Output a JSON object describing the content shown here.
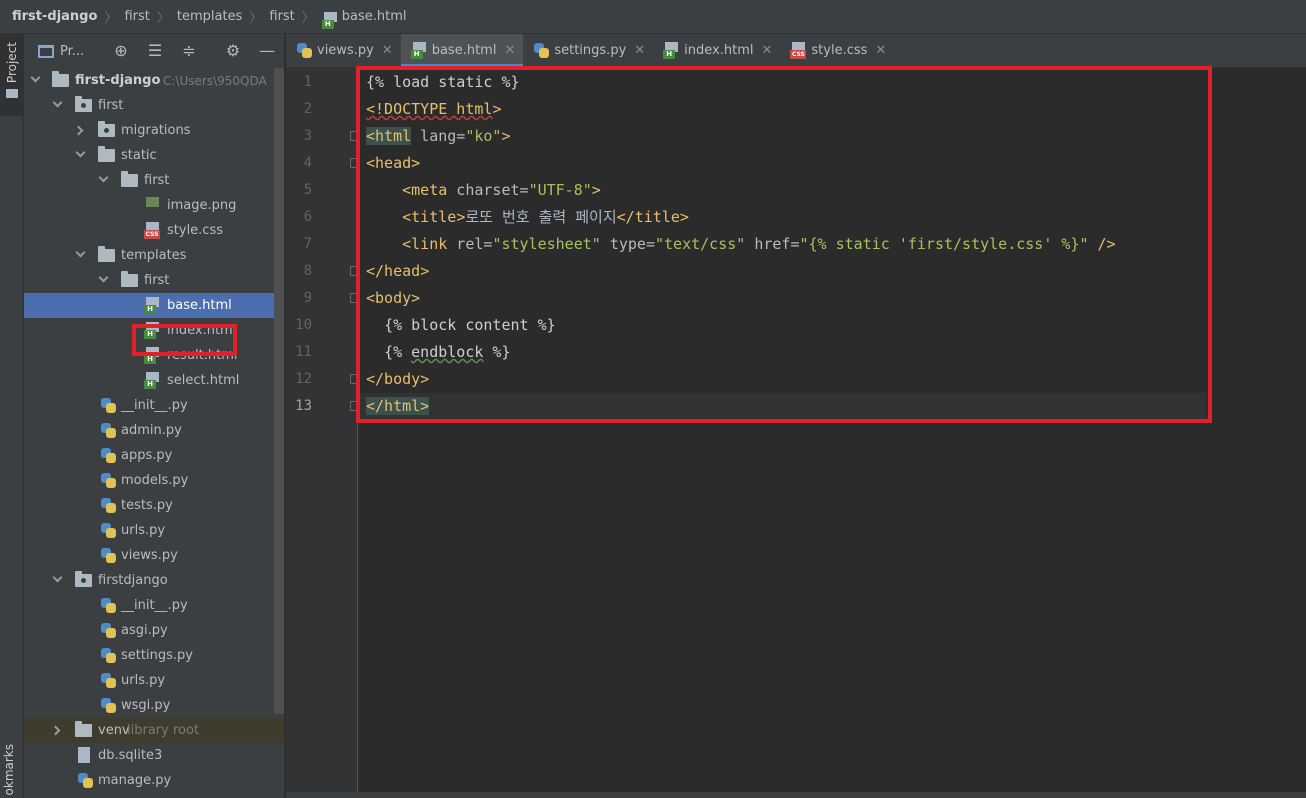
{
  "breadcrumb": [
    "first-django",
    "first",
    "templates",
    "first",
    "base.html"
  ],
  "stripe": {
    "project_label": "Project",
    "bookmarks_label": "okmarks"
  },
  "project_panel": {
    "title": "Pr...",
    "root_name": "first-django",
    "root_path": "C:\\Users\\950QDA",
    "items": [
      {
        "label": "first"
      },
      {
        "label": "migrations"
      },
      {
        "label": "static"
      },
      {
        "label": "first"
      },
      {
        "label": "image.png"
      },
      {
        "label": "style.css"
      },
      {
        "label": "templates"
      },
      {
        "label": "first"
      },
      {
        "label": "base.html"
      },
      {
        "label": "index.html"
      },
      {
        "label": "result.html"
      },
      {
        "label": "select.html"
      },
      {
        "label": "__init__.py"
      },
      {
        "label": "admin.py"
      },
      {
        "label": "apps.py"
      },
      {
        "label": "models.py"
      },
      {
        "label": "tests.py"
      },
      {
        "label": "urls.py"
      },
      {
        "label": "views.py"
      },
      {
        "label": "firstdjango"
      },
      {
        "label": "__init__.py"
      },
      {
        "label": "asgi.py"
      },
      {
        "label": "settings.py"
      },
      {
        "label": "urls.py"
      },
      {
        "label": "wsgi.py"
      },
      {
        "label": "venv",
        "note": "library root"
      },
      {
        "label": "db.sqlite3"
      },
      {
        "label": "manage.py"
      }
    ]
  },
  "tabs": [
    {
      "label": "views.py",
      "icon": "python-file-icon"
    },
    {
      "label": "base.html",
      "icon": "html-file-icon",
      "active": true
    },
    {
      "label": "settings.py",
      "icon": "python-file-icon"
    },
    {
      "label": "index.html",
      "icon": "html-file-icon"
    },
    {
      "label": "style.css",
      "icon": "css-file-icon"
    }
  ],
  "editor": {
    "current_line": 13,
    "line_numbers": [
      "1",
      "2",
      "3",
      "4",
      "5",
      "6",
      "7",
      "8",
      "9",
      "10",
      "11",
      "12",
      "13"
    ],
    "lines": [
      "{% load static %}",
      "<!DOCTYPE html>",
      "<html lang=\"ko\">",
      "<head>",
      "    <meta charset=\"UTF-8\">",
      "    <title>로또 번호 출력 페이지</title>",
      "    <link rel=\"stylesheet\" type=\"text/css\" href=\"{% static 'first/style.css' %}\" />",
      "</head>",
      "<body>",
      "  {% block content %}",
      "  {% endblock %}",
      "</body>",
      "</html>"
    ]
  },
  "colors": {
    "highlight_box": "#e0202a",
    "selection": "#4b6eaf",
    "tag": "#e8bf6a",
    "string": "#a5c25c"
  }
}
